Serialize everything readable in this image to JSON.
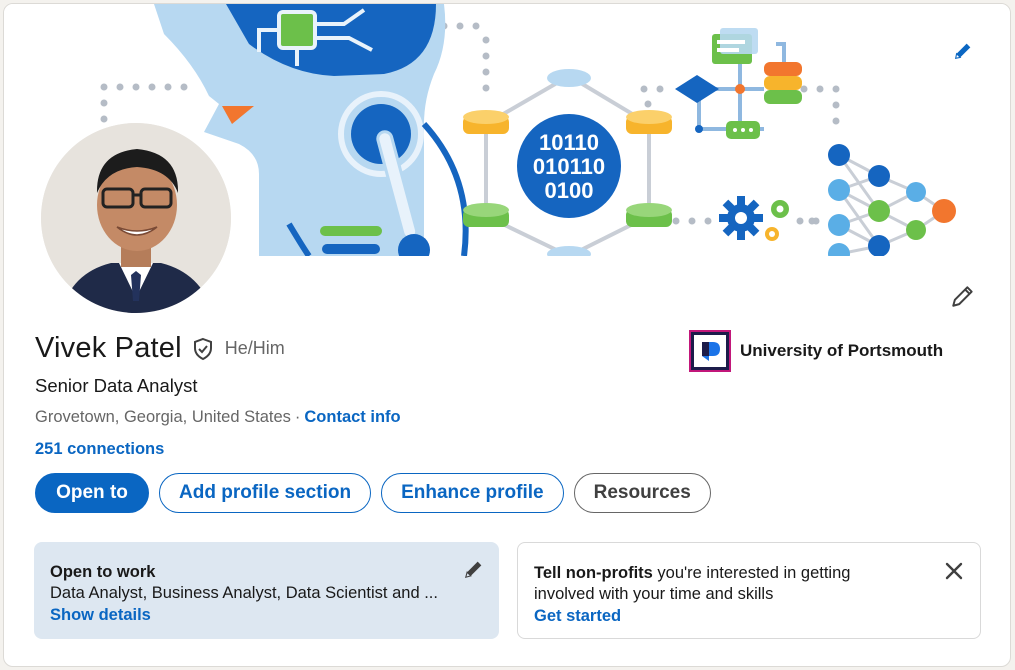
{
  "profile": {
    "name": "Vivek Patel",
    "pronouns": "He/Him",
    "headline": "Senior Data Analyst",
    "location": "Grovetown, Georgia, United States",
    "separator": "·",
    "contact_info_label": "Contact info",
    "connections_label": "251 connections"
  },
  "education": {
    "name": "University of Portsmouth",
    "logo_icon": "university-of-portsmouth-logo"
  },
  "banner": {
    "binary_lines": [
      "10110",
      "010110",
      "0100"
    ]
  },
  "actions": {
    "open_to": "Open to",
    "add_section": "Add profile section",
    "enhance": "Enhance profile",
    "resources": "Resources"
  },
  "open_to_work": {
    "title": "Open to work",
    "roles": "Data Analyst, Business Analyst, Data Scientist and ...",
    "link": "Show details"
  },
  "nonprofit": {
    "lead": "Tell non-profits",
    "rest": " you're interested in getting involved with your time and skills",
    "link": "Get started"
  },
  "icons": {
    "banner_edit": "pencil-icon",
    "profile_edit": "pencil-icon",
    "verified": "verified-shield-icon",
    "close": "close-icon"
  },
  "colors": {
    "accent": "#0a66c2",
    "otw_background": "#dde7f1",
    "text_primary": "#191919",
    "text_secondary": "#666666"
  }
}
